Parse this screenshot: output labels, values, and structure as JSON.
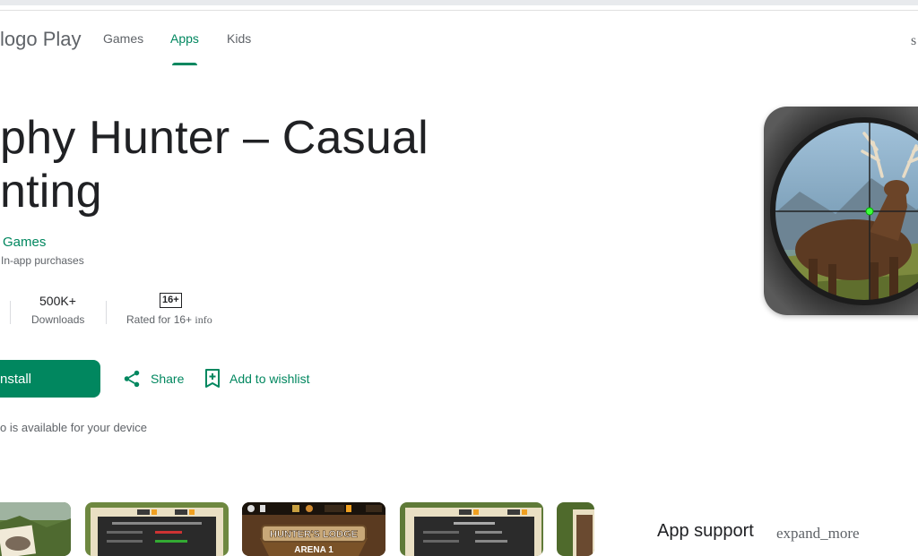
{
  "header": {
    "brand": "logo Play",
    "nav": [
      "Games",
      "Apps",
      "Kids"
    ],
    "active_tab": "Apps",
    "right_glyph": "s"
  },
  "app": {
    "title_line1": "phy Hunter – Casual",
    "title_line2": "nting",
    "developer": "Games",
    "purchases": "In-app purchases",
    "downloads_value": "500K+",
    "downloads_label": "Downloads",
    "content_rating_badge": "16+",
    "content_rating_label": "Rated for 16+",
    "content_rating_info": "info"
  },
  "actions": {
    "install": "nstall",
    "share": "Share",
    "wishlist": "Add to wishlist"
  },
  "availability": "o is available for your device",
  "screenshots": {
    "shot3_banner": "HUNTER'S LODGE",
    "shot3_sub": "ARENA 1"
  },
  "sidebar": {
    "app_support": "App support",
    "expand_icon_text": "expand_more"
  },
  "colors": {
    "accent": "#01875f",
    "text": "#202124",
    "muted": "#5f6368"
  }
}
